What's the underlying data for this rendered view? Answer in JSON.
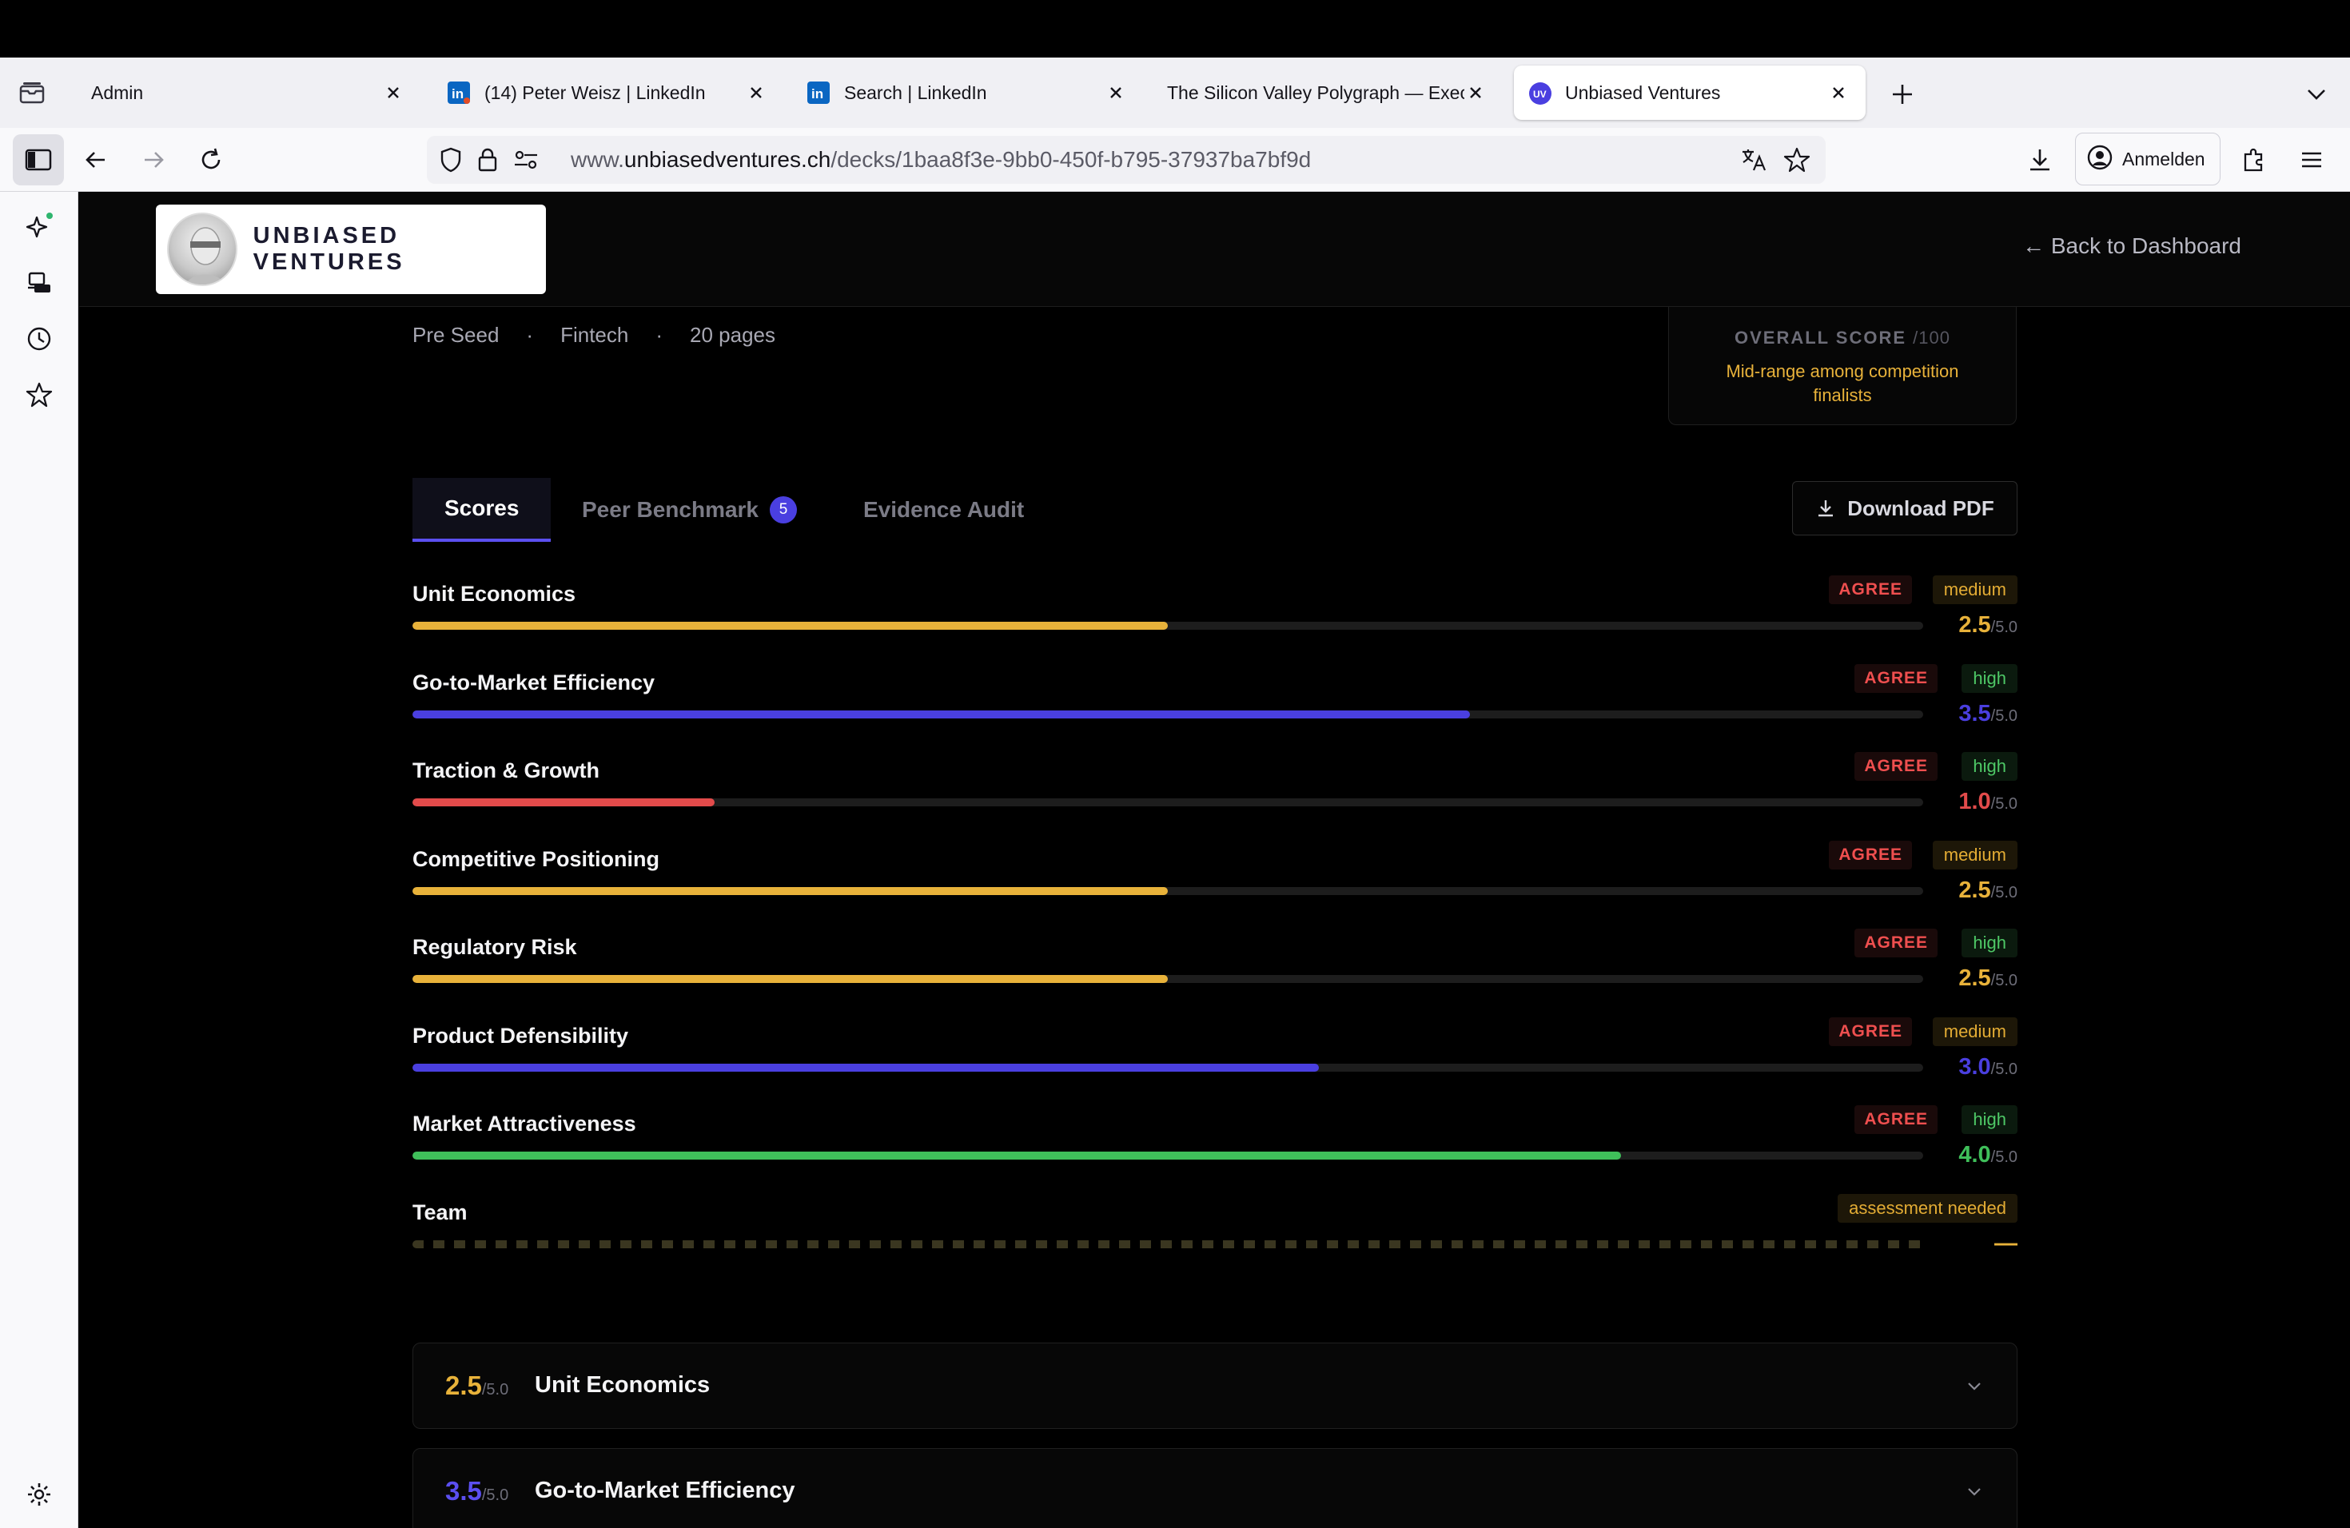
{
  "browser": {
    "tabs": [
      {
        "title": "Admin",
        "favicon": "none",
        "active": false
      },
      {
        "title": "(14) Peter Weisz | LinkedIn",
        "favicon": "linkedin-icon",
        "active": false
      },
      {
        "title": "Search | LinkedIn",
        "favicon": "linkedin-icon",
        "active": false
      },
      {
        "title": "The Silicon Valley Polygraph — Executive",
        "favicon": "none",
        "active": false
      },
      {
        "title": "Unbiased Ventures",
        "favicon": "uv-icon",
        "active": true
      }
    ],
    "url_prefix": "www.",
    "url_domain": "unbiasedventures.ch",
    "url_path": "/decks/1baa8f3e-9bb0-450f-b795-37937ba7bf9d",
    "signin_label": "Anmelden",
    "uv_favicon_text": "UV"
  },
  "header": {
    "brand": "UNBIASED VENTURES",
    "back_link": "← Back to Dashboard"
  },
  "deck": {
    "stage": "Pre Seed",
    "sector": "Fintech",
    "pages": "20 pages",
    "separator": "·",
    "overall_score_label": "OVERALL SCORE",
    "overall_score_denominator": "/100",
    "overall_score_note": "Mid-range among competition finalists"
  },
  "tabs": {
    "scores": "Scores",
    "peer_benchmark": "Peer Benchmark",
    "peer_benchmark_count": "5",
    "evidence_audit": "Evidence Audit",
    "download_pdf": "Download PDF"
  },
  "scores": {
    "denominator": "/5.0",
    "rows": [
      {
        "label": "Unit Economics",
        "agree": "AGREE",
        "confidence": "medium",
        "value": "2.5",
        "fraction": 0.5,
        "color": "#e8b23a"
      },
      {
        "label": "Go-to-Market Efficiency",
        "agree": "AGREE",
        "confidence": "high",
        "value": "3.5",
        "fraction": 0.7,
        "color": "#4a3fe0"
      },
      {
        "label": "Traction & Growth",
        "agree": "AGREE",
        "confidence": "high",
        "value": "1.0",
        "fraction": 0.2,
        "color": "#e24b4b"
      },
      {
        "label": "Competitive Positioning",
        "agree": "AGREE",
        "confidence": "medium",
        "value": "2.5",
        "fraction": 0.5,
        "color": "#e8b23a"
      },
      {
        "label": "Regulatory Risk",
        "agree": "AGREE",
        "confidence": "high",
        "value": "2.5",
        "fraction": 0.5,
        "color": "#e8b23a"
      },
      {
        "label": "Product Defensibility",
        "agree": "AGREE",
        "confidence": "medium",
        "value": "3.0",
        "fraction": 0.6,
        "color": "#4a3fe0"
      },
      {
        "label": "Market Attractiveness",
        "agree": "AGREE",
        "confidence": "high",
        "value": "4.0",
        "fraction": 0.8,
        "color": "#3fbf5a"
      },
      {
        "label": "Team",
        "agree": "",
        "confidence": "assessment needed",
        "value": "—",
        "fraction": 0,
        "color": "#e8b23a"
      }
    ]
  },
  "details": [
    {
      "score": "2.5",
      "title": "Unit Economics",
      "color": "#e8b23a"
    },
    {
      "score": "3.5",
      "title": "Go-to-Market Efficiency",
      "color": "#4a3fe0"
    }
  ]
}
